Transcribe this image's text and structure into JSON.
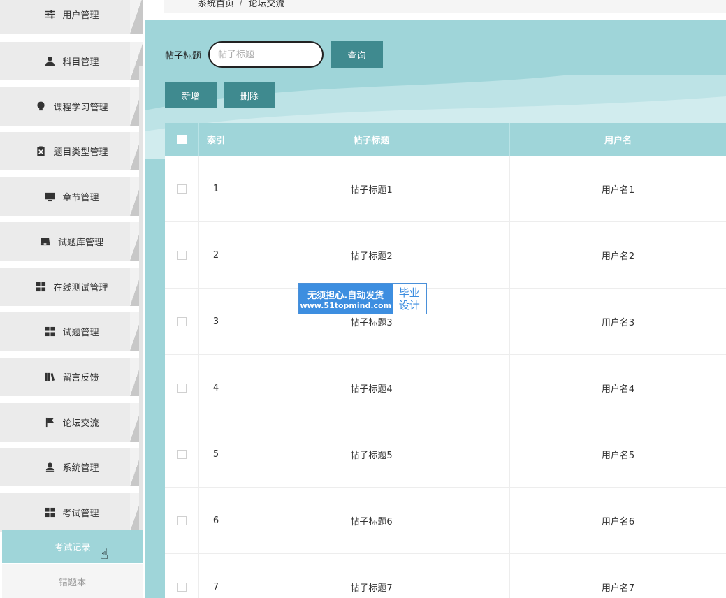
{
  "sidebar": {
    "items": [
      {
        "label": "用户管理",
        "icon": "sliders-icon"
      },
      {
        "label": "科目管理",
        "icon": "user-icon"
      },
      {
        "label": "课程学习管理",
        "icon": "bulb-icon"
      },
      {
        "label": "题目类型管理",
        "icon": "clipboard-icon"
      },
      {
        "label": "章节管理",
        "icon": "monitor-icon"
      },
      {
        "label": "试题库管理",
        "icon": "inbox-icon"
      },
      {
        "label": "在线测试管理",
        "icon": "grid-icon"
      },
      {
        "label": "试题管理",
        "icon": "grid-icon"
      },
      {
        "label": "留言反馈",
        "icon": "books-icon"
      },
      {
        "label": "论坛交流",
        "icon": "flag-icon"
      },
      {
        "label": "系统管理",
        "icon": "person-icon"
      },
      {
        "label": "考试管理",
        "icon": "grid-icon"
      }
    ],
    "sub_items": [
      {
        "label": "考试记录",
        "active": true
      },
      {
        "label": "错题本",
        "active": false
      }
    ]
  },
  "breadcrumb": {
    "home": "系统首页",
    "separator": "/",
    "current": "论坛交流"
  },
  "search": {
    "label": "帖子标题",
    "placeholder": "帖子标题",
    "query_button": "查询"
  },
  "actions": {
    "add_button": "新增",
    "delete_button": "删除"
  },
  "table": {
    "headers": {
      "index": "索引",
      "title": "帖子标题",
      "username": "用户名"
    },
    "rows": [
      {
        "index": "1",
        "title": "帖子标题1",
        "username": "用户名1"
      },
      {
        "index": "2",
        "title": "帖子标题2",
        "username": "用户名2"
      },
      {
        "index": "3",
        "title": "帖子标题3",
        "username": "用户名3"
      },
      {
        "index": "4",
        "title": "帖子标题4",
        "username": "用户名4"
      },
      {
        "index": "5",
        "title": "帖子标题5",
        "username": "用户名5"
      },
      {
        "index": "6",
        "title": "帖子标题6",
        "username": "用户名6"
      },
      {
        "index": "7",
        "title": "帖子标题7",
        "username": "用户名7"
      }
    ]
  },
  "watermark": {
    "line1": "无须担心.自动发货",
    "line2": "www.51topmind.com",
    "badge_line1": "毕业",
    "badge_line2": "设计"
  },
  "colors": {
    "accent": "#9fd5d9",
    "button": "#3f8a8f",
    "sidebar_bg": "#ebebeb"
  }
}
